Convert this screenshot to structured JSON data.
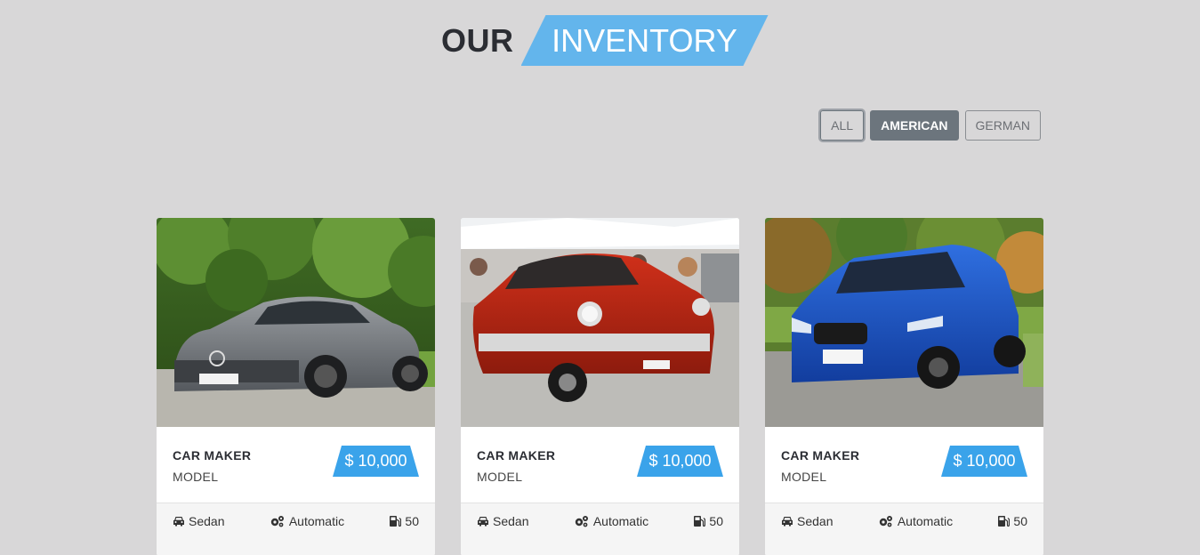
{
  "header": {
    "title_plain": "OUR",
    "title_accent": "INVENTORY"
  },
  "filters": [
    {
      "label": "ALL",
      "state": "focused"
    },
    {
      "label": "AMERICAN",
      "state": "active"
    },
    {
      "label": "GERMAN",
      "state": "default"
    }
  ],
  "cards": [
    {
      "maker": "CAR MAKER",
      "model": "MODEL",
      "price": "$ 10,000",
      "body": "Sedan",
      "transmission": "Automatic",
      "fuel": "50",
      "image": "silver-mercedes-amg-car-photo"
    },
    {
      "maker": "CAR MAKER",
      "model": "MODEL",
      "price": "$ 10,000",
      "body": "Sedan",
      "transmission": "Automatic",
      "fuel": "50",
      "image": "red-vintage-chevrolet-car-photo"
    },
    {
      "maker": "CAR MAKER",
      "model": "MODEL",
      "price": "$ 10,000",
      "body": "Sedan",
      "transmission": "Automatic",
      "fuel": "50",
      "image": "blue-bmw-car-photo"
    }
  ],
  "colors": {
    "background": "#d8d7d8",
    "accent": "#63b5ec",
    "price_tag": "#3aa3ea",
    "active_filter": "#6c757d"
  },
  "icons": {
    "body": "car-icon",
    "transmission": "gears-icon",
    "fuel": "gas-pump-icon"
  }
}
